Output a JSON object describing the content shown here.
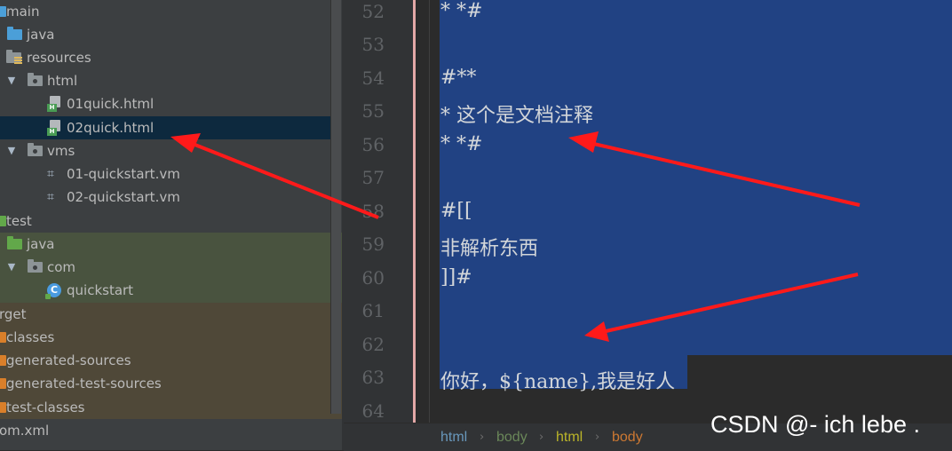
{
  "tree": {
    "items": [
      {
        "label": "main"
      },
      {
        "label": "java"
      },
      {
        "label": "resources"
      },
      {
        "label": "html"
      },
      {
        "label": "01quick.html"
      },
      {
        "label": "02quick.html"
      },
      {
        "label": "vms"
      },
      {
        "label": "01-quickstart.vm"
      },
      {
        "label": "02-quickstart.vm"
      },
      {
        "label": "test"
      },
      {
        "label": "java"
      },
      {
        "label": "com"
      },
      {
        "label": "quickstart"
      },
      {
        "label": "rget"
      },
      {
        "label": "classes"
      },
      {
        "label": "generated-sources"
      },
      {
        "label": "generated-test-sources"
      },
      {
        "label": "test-classes"
      },
      {
        "label": "om.xml"
      }
    ],
    "class_icon_letter": "C",
    "html_badge": "H",
    "selected_item": "02quick.html"
  },
  "editor": {
    "line_numbers": [
      "52",
      "53",
      "54",
      "55",
      "56",
      "57",
      "58",
      "59",
      "60",
      "61",
      "62",
      "63",
      "64"
    ],
    "lines": [
      "* *#",
      "",
      "#**",
      "*   这个是文档注释",
      "* *#",
      "",
      "#[[",
      "非解析东西",
      "]]#",
      "",
      "",
      "你好，${name},我是好人",
      ""
    ]
  },
  "breadcrumb": [
    {
      "label": "html",
      "color": "#6897bb"
    },
    {
      "label": "body",
      "color": "#6a8759"
    },
    {
      "label": "html",
      "color": "#bbb529"
    },
    {
      "label": "body",
      "color": "#cc7832"
    }
  ],
  "watermark": "CSDN @- ich lebe .",
  "colors": {
    "selection": "#214283",
    "annotation_arrow": "#ff1a1a",
    "tree_selected_row": "#0d293e"
  }
}
